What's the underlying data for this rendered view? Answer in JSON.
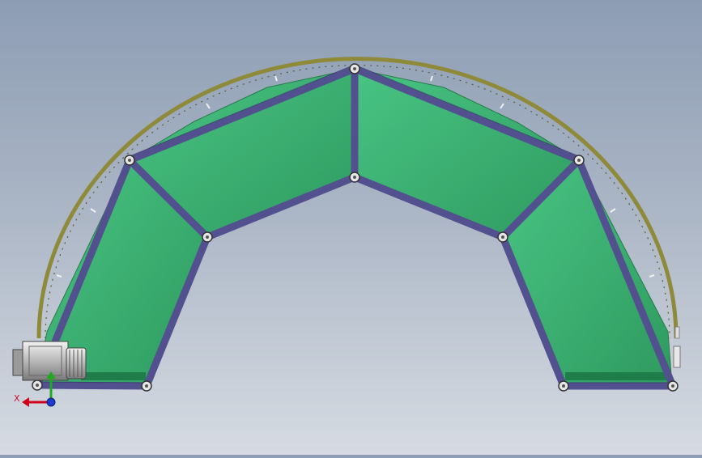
{
  "viewport": {
    "background_top": "#8d9db4",
    "background_bottom": "#d6dbe2"
  },
  "model": {
    "panel_color": "#3aa96d",
    "panel_highlight": "#48c483",
    "frame_color": "#52508f",
    "frame_edge": "#2e2c5a",
    "rail_color": "#8f8a3a",
    "pivot_color": "#e6e6e6"
  },
  "triad": {
    "x_label": "X",
    "x_color": "#d0021b",
    "y_color": "#22a820",
    "z_color": "#1a3cd0"
  }
}
